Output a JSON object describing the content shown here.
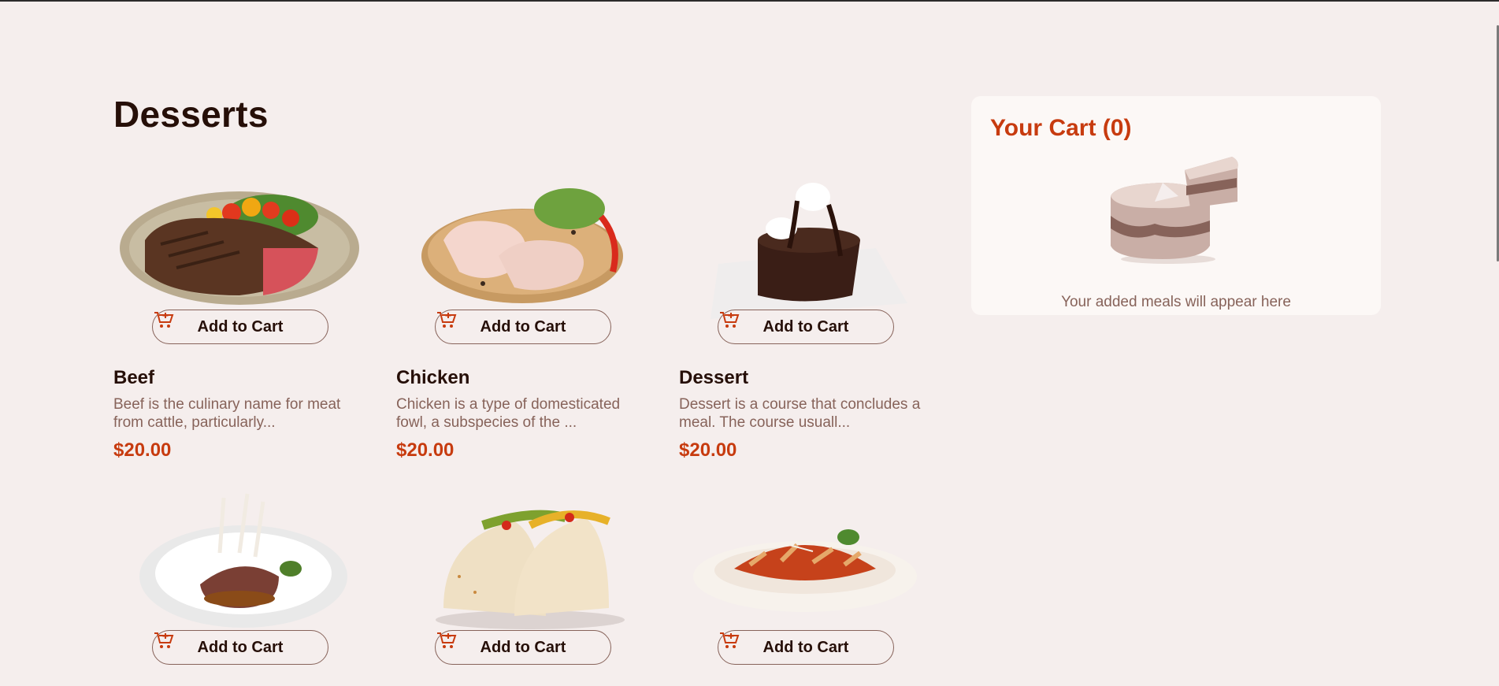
{
  "page": {
    "title": "Desserts"
  },
  "colors": {
    "accent": "#c73b0f",
    "muted": "#87635a",
    "background": "#f5eeed"
  },
  "meals": [
    {
      "name": "Beef",
      "description": "Beef is the culinary name for meat from cattle, particularly...",
      "price": "$20.00",
      "button": "Add to Cart",
      "image": "beef-steak-image"
    },
    {
      "name": "Chicken",
      "description": "Chicken is a type of domesticated fowl, a subspecies of the ...",
      "price": "$20.00",
      "button": "Add to Cart",
      "image": "raw-chicken-image"
    },
    {
      "name": "Dessert",
      "description": "Dessert is a course that concludes a meal. The course usuall...",
      "price": "$20.00",
      "button": "Add to Cart",
      "image": "chocolate-cake-image"
    },
    {
      "button": "Add to Cart",
      "image": "lamb-chops-image"
    },
    {
      "button": "Add to Cart",
      "image": "tacos-image"
    },
    {
      "button": "Add to Cart",
      "image": "penne-pasta-image"
    }
  ],
  "cart": {
    "title": "Your Cart (0)",
    "empty_message": "Your added meals will appear here",
    "illustration": "empty-cart-cake-icon"
  }
}
